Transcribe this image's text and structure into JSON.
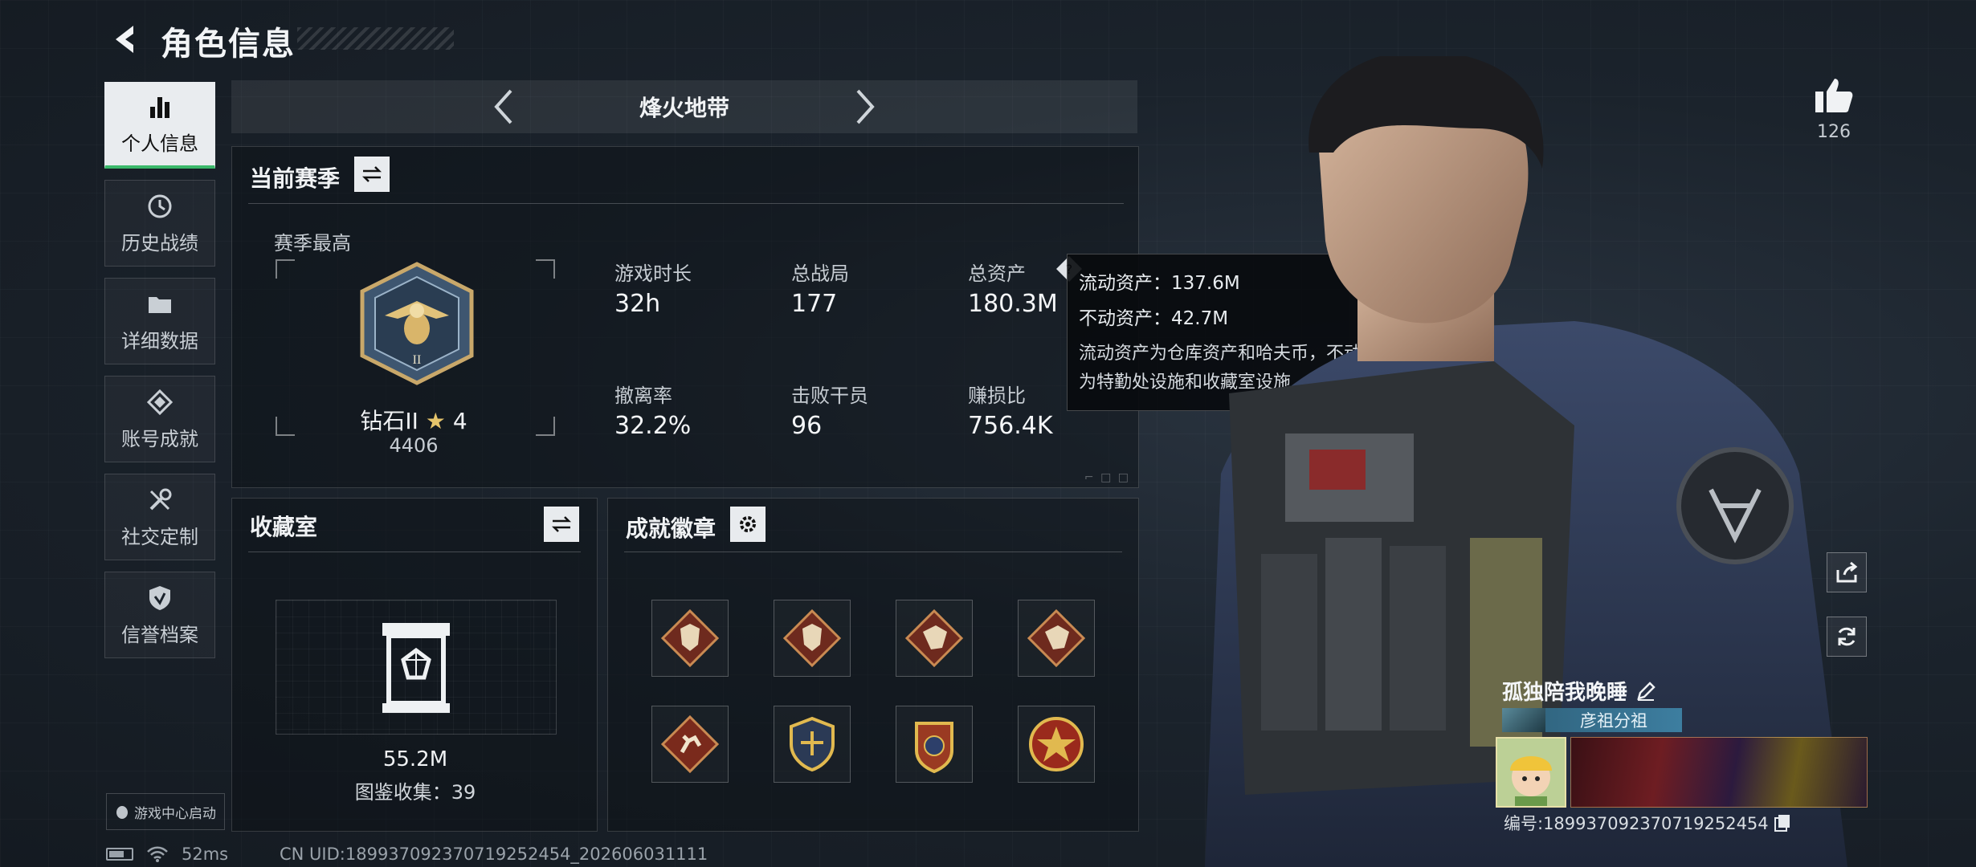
{
  "header": {
    "title": "角色信息"
  },
  "nav": {
    "items": [
      {
        "label": "个人信息",
        "icon": "bar-chart-icon"
      },
      {
        "label": "历史战绩",
        "icon": "history-icon"
      },
      {
        "label": "详细数据",
        "icon": "folder-icon"
      },
      {
        "label": "账号成就",
        "icon": "achievement-icon"
      },
      {
        "label": "社交定制",
        "icon": "tools-icon"
      },
      {
        "label": "信誉档案",
        "icon": "credit-shield-icon"
      }
    ],
    "game_center_label": "游戏中心启动"
  },
  "mode": {
    "name": "烽火地带"
  },
  "season": {
    "title": "当前赛季",
    "best_label": "赛季最高",
    "rank_name": "钻石II",
    "rank_stars": "4",
    "rank_score": "4406",
    "stats": [
      {
        "label": "游戏时长",
        "value": "32h"
      },
      {
        "label": "总战局",
        "value": "177"
      },
      {
        "label": "总资产",
        "value": "180.3M"
      },
      {
        "label": "撤离率",
        "value": "32.2%"
      },
      {
        "label": "击败干员",
        "value": "96"
      },
      {
        "label": "赚损比",
        "value": "756.4K"
      }
    ]
  },
  "tooltip": {
    "liquid": "流动资产：137.6M",
    "fixed": "不动资产：42.7M",
    "desc_line1": "流动资产为仓库资产和哈夫币，不动资产",
    "desc_line2": "为特勤处设施和收藏室设施"
  },
  "collection": {
    "title": "收藏室",
    "value": "55.2M",
    "catalog": "图鉴收集：39"
  },
  "badges": {
    "title": "成就徽章",
    "items": [
      "wolf-badge",
      "wolf-badge",
      "dragon-badge",
      "dragon-badge",
      "runner-badge",
      "shield-badge",
      "eagle-badge",
      "star-badge"
    ]
  },
  "profile": {
    "likes": "126",
    "name": "孤独陪我晚睡",
    "clan": "彦祖分祖",
    "id": "编号:189937092370719252454"
  },
  "status_bar": {
    "ping": "52ms",
    "uid": "CN UID:189937092370719252454_202606031111"
  },
  "colors": {
    "accent_green": "#3ab86a",
    "clan_blue": "#3d7ea0"
  }
}
